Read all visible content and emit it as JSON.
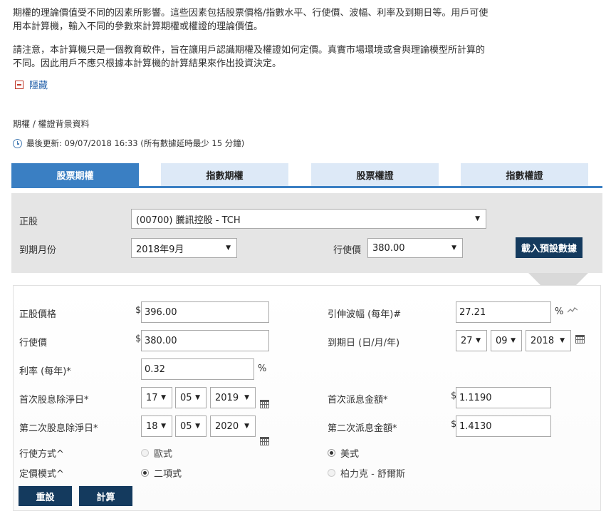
{
  "intro": {
    "para1_line1": "期權的理論價值受不同的因素所影響。這些因素包括股票價格/指數水平、行使價、波幅、利率及到期日等。用戶可使",
    "para1_line2": "用本計算機，輸入不同的參數來計算期權或權證的理論價值。",
    "para2_line1": "請注意，本計算機只是一個教育軟件，旨在讓用戶認識期權及權證如何定價。真實市場環境或會與理論模型所計算的",
    "para2_line2": "不同。因此用戶不應只根據本計算機的計算結果來作出投資決定。",
    "hide_label": "隱藏"
  },
  "section": {
    "title": "期權 / 權證背景資料",
    "last_update": "最後更新: 09/07/2018 16:33 (所有數據延時最少 15 分鐘)"
  },
  "tabs": [
    {
      "label": "股票期權",
      "active": true
    },
    {
      "label": "指數期權",
      "active": false
    },
    {
      "label": "股票權證",
      "active": false
    },
    {
      "label": "指數權證",
      "active": false
    }
  ],
  "selector": {
    "underlying_label": "正股",
    "underlying_value": "(00700) 騰訊控股 - TCH",
    "expiry_label": "到期月份",
    "expiry_value": "2018年9月",
    "strike_label": "行使價",
    "strike_value": "380.00",
    "load_button": "載入預設數據"
  },
  "form": {
    "stock_price_label": "正股價格",
    "stock_price_value": "396.00",
    "implied_vol_label": "引伸波幅 (每年)#",
    "implied_vol_value": "27.21",
    "strike_label": "行使價",
    "strike_value": "380.00",
    "expiry_date_label": "到期日 (日/月/年)",
    "expiry_day": "27",
    "expiry_month": "09",
    "expiry_year": "2018",
    "rate_label": "利率 (每年)*",
    "rate_value": "0.32",
    "first_exdiv_label": "首次股息除淨日*",
    "first_exdiv_day": "17",
    "first_exdiv_month": "05",
    "first_exdiv_year": "2019",
    "first_div_label": "首次派息金額*",
    "first_div_value": "1.1190",
    "second_exdiv_label": "第二次股息除淨日*",
    "second_exdiv_day": "18",
    "second_exdiv_month": "05",
    "second_exdiv_year": "2020",
    "second_div_label": "第二次派息金額*",
    "second_div_value": "1.4130",
    "exercise_label": "行使方式^",
    "exercise_european": "歐式",
    "exercise_american": "美式",
    "pricing_label": "定價模式^",
    "pricing_binomial": "二項式",
    "pricing_bs": "柏力克 - 舒爾斯",
    "reset_button": "重設",
    "calc_button": "計算",
    "currency": "$",
    "percent": "%"
  },
  "colors": {
    "tab_active": "#3a7fc3",
    "tab_inactive": "#dde9f7",
    "button_dark": "#143a5e",
    "link_blue": "#1f5ea8",
    "toggle_red": "#c0392b"
  }
}
